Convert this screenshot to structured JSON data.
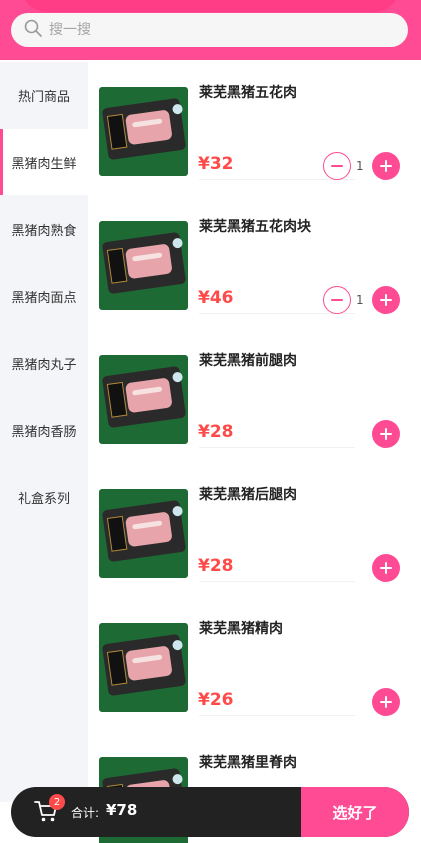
{
  "search": {
    "placeholder": "搜一搜",
    "icon": "search-icon"
  },
  "colors": {
    "accent": "#ff4b93",
    "price": "#ff4a4a",
    "footer": "#222222"
  },
  "sidebar": {
    "items": [
      {
        "label": "热门商品"
      },
      {
        "label": "黑猪肉生鲜"
      },
      {
        "label": "黑猪肉熟食"
      },
      {
        "label": "黑猪肉面点"
      },
      {
        "label": "黑猪肉丸子"
      },
      {
        "label": "黑猪肉香肠"
      },
      {
        "label": "礼盒系列"
      }
    ]
  },
  "products": [
    {
      "name": "莱芜黑猪五花肉",
      "price": "¥32",
      "qty": "1"
    },
    {
      "name": "莱芜黑猪五花肉块",
      "price": "¥46",
      "qty": "1"
    },
    {
      "name": "莱芜黑猪前腿肉",
      "price": "¥28"
    },
    {
      "name": "莱芜黑猪后腿肉",
      "price": "¥28"
    },
    {
      "name": "莱芜黑猪精肉",
      "price": "¥26"
    },
    {
      "name": "莱芜黑猪里脊肉"
    }
  ],
  "cart": {
    "count": "2",
    "total_label": "合计:",
    "total_value": "¥78",
    "confirm_label": "选好了"
  }
}
